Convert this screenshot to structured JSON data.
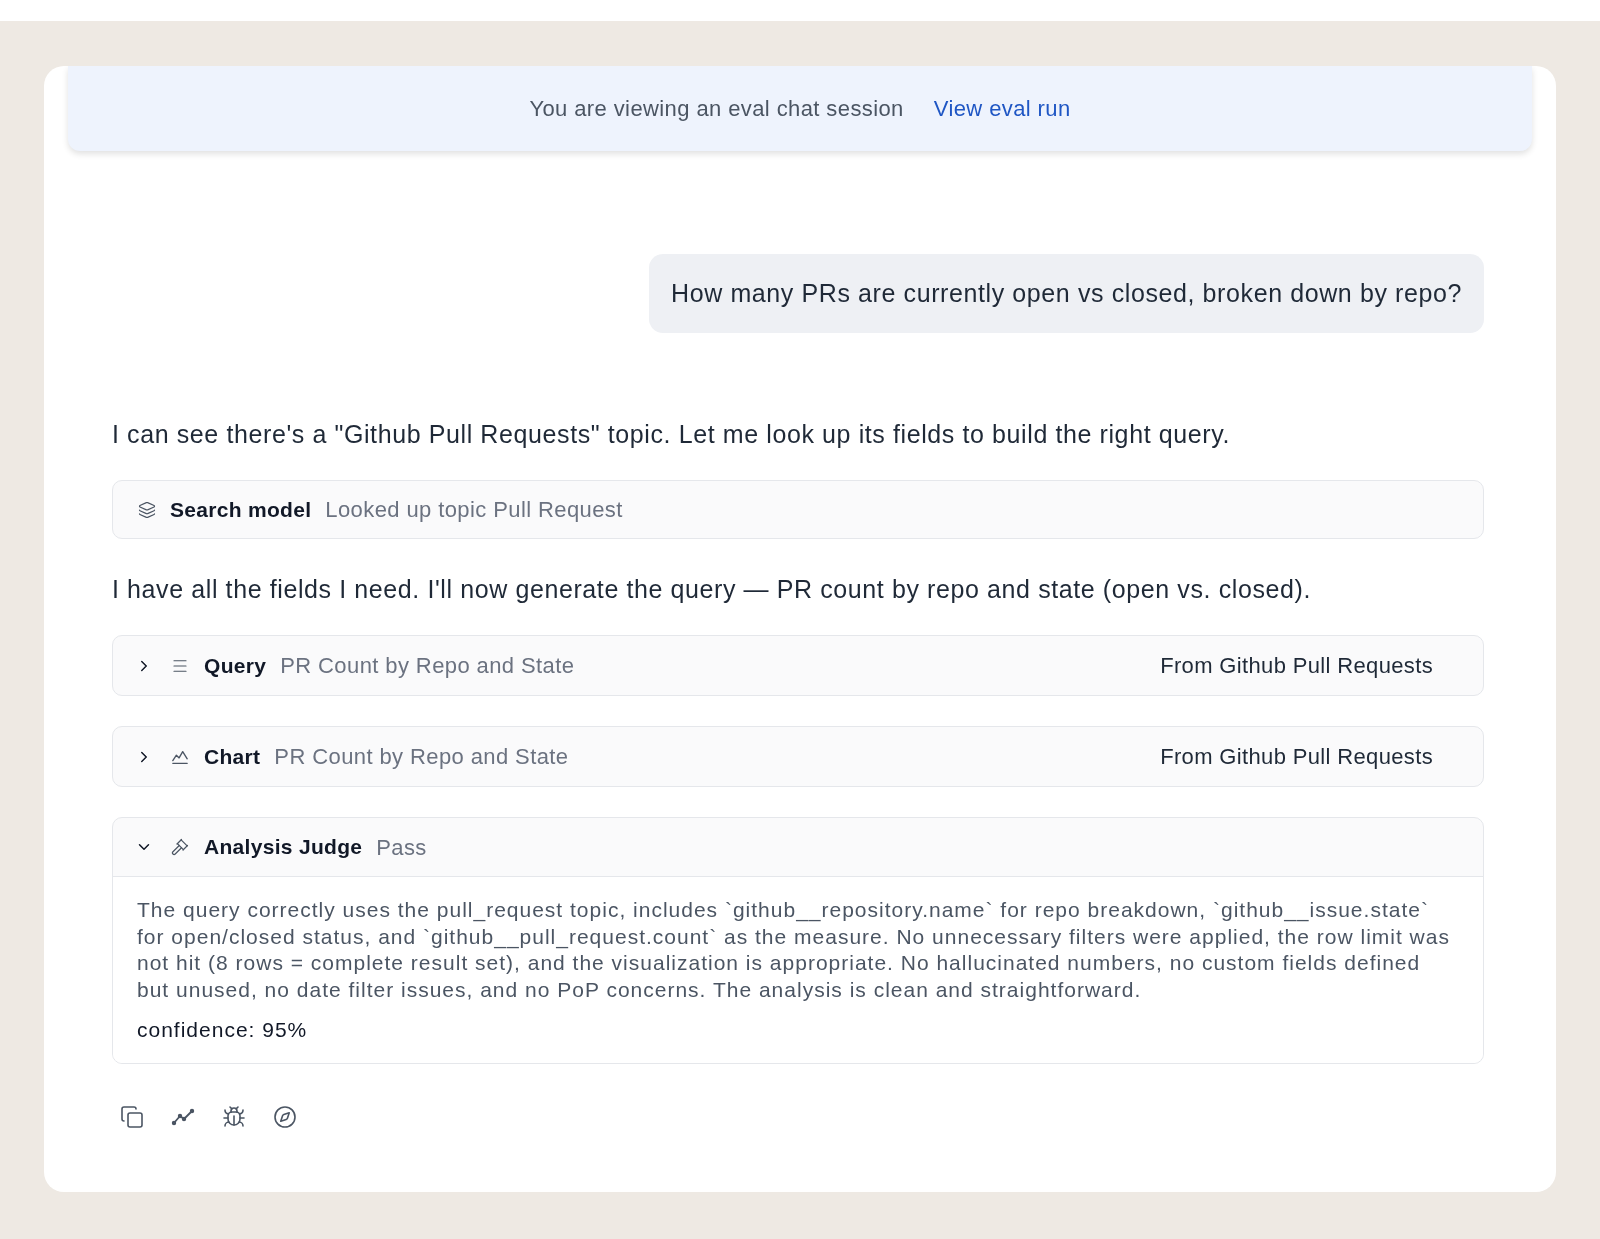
{
  "banner": {
    "message": "You are viewing an eval chat session",
    "link": "View eval run"
  },
  "user_message": {
    "text": "How many PRs are currently open vs closed, broken down by repo?"
  },
  "assistant": [
    {
      "kind": "text",
      "text": "I can see there's a \"Github Pull Requests\" topic. Let me look up its fields to build the right query."
    },
    {
      "kind": "search",
      "title": "Search model",
      "detail": "Looked up topic Pull Request"
    },
    {
      "kind": "text",
      "text": "I have all the fields I need. I'll now generate the query — PR count by repo and state (open vs. closed)."
    },
    {
      "kind": "query",
      "title": "Query",
      "detail": "PR Count by Repo and State",
      "source": "From Github Pull Requests",
      "expanded": false
    },
    {
      "kind": "chart",
      "title": "Chart",
      "detail": "PR Count by Repo and State",
      "source": "From Github Pull Requests",
      "expanded": false
    },
    {
      "kind": "judge",
      "title": "Analysis Judge",
      "detail": "Pass",
      "expanded": true,
      "summary": "The query correctly uses the pull_request topic, includes `github__repository.name` for repo breakdown, `github__issue.state` for open/closed status, and `github__pull_request.count` as the measure. No unnecessary filters were applied, the row limit was not hit (8 rows = complete result set), and the visualization is appropriate. No hallucinated numbers, no custom fields defined but unused, no date filter issues, and no PoP concerns. The analysis is clean and straightforward.",
      "confidence": "confidence: 95%"
    }
  ]
}
